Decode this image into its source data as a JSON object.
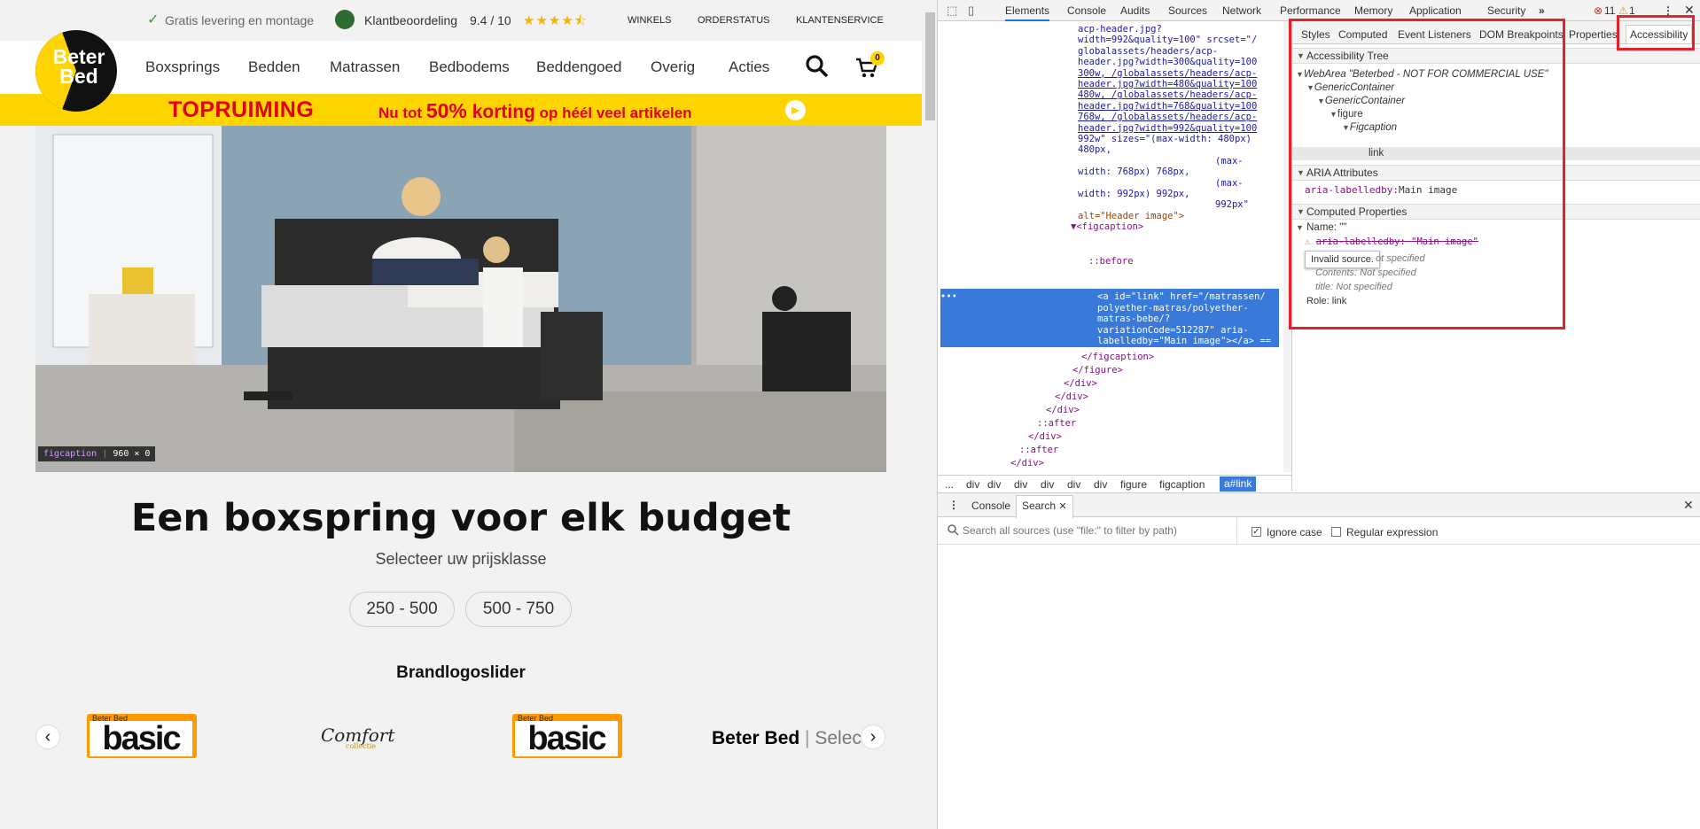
{
  "site": {
    "topbar": {
      "delivery": "Gratis levering en montage",
      "rating_label": "Klantbeoordeling",
      "rating_value": "9.4 / 10",
      "stars": 4.5,
      "links": [
        "WINKELS",
        "ORDERSTATUS",
        "KLANTENSERVICE"
      ]
    },
    "logo": {
      "line1": "Beter",
      "line2": "Bed"
    },
    "nav": [
      "Boxsprings",
      "Bedden",
      "Matrassen",
      "Bedbodems",
      "Beddengoed",
      "Overig",
      "Acties"
    ],
    "cart_count": "0",
    "promo": {
      "title": "TOPRUIMING",
      "pre": "Nu tot ",
      "percent": "50%",
      "korting": " korting",
      "post": " op héél veel artikelen"
    },
    "hero_tooltip": {
      "tag": "figcaption",
      "size": "960 × 0"
    },
    "headline": "Een boxspring voor elk budget",
    "subheading": "Selecteer uw prijsklasse",
    "price_ranges": [
      "250 - 500",
      "500 - 750"
    ],
    "brand_title": "Brandlogoslider",
    "brands": {
      "basic_small": "Beter Bed",
      "basic": "basic",
      "comfort": "Comfort",
      "comfort_sub": "collectie",
      "select_brand": "Beter Bed",
      "select_word": "Select"
    }
  },
  "devtools": {
    "tabs": [
      "Elements",
      "Console",
      "Audits",
      "Sources",
      "Network",
      "Performance",
      "Memory",
      "Application",
      "Security"
    ],
    "active_tab": "Elements",
    "errors": "11",
    "warnings": "1",
    "code_lines": [
      {
        "text": "acp-header.jpg?",
        "cls": "av"
      },
      {
        "text": "width=992&quality=100\" srcset=\"/",
        "cls": "av"
      },
      {
        "text": "globalassets/headers/acp-",
        "cls": "av"
      },
      {
        "text": "header.jpg?width=300&quality=100",
        "cls": "av"
      },
      {
        "text": "300w, /globalassets/headers/acp-",
        "cls": "av"
      },
      {
        "text": "header.jpg?width=480&quality=100",
        "cls": "av"
      },
      {
        "text": "480w, /globalassets/headers/acp-",
        "cls": "av"
      },
      {
        "text": "header.jpg?width=768&quality=100",
        "cls": "av"
      },
      {
        "text": "768w, /globalassets/headers/acp-",
        "cls": "av"
      },
      {
        "text": "header.jpg?width=992&quality=100",
        "cls": "av"
      },
      {
        "text": "992w\" sizes=\"(max-width: 480px)",
        "cls": "av"
      },
      {
        "text": "480px,",
        "cls": "av"
      },
      {
        "text": "(max-",
        "cls": "av"
      },
      {
        "text": "width: 768px) 768px,",
        "cls": "av"
      },
      {
        "text": "(max-",
        "cls": "av"
      },
      {
        "text": "width: 992px) 992px,",
        "cls": "av"
      },
      {
        "text": "992px\"",
        "cls": "av"
      },
      {
        "text": "alt=\"Header image\">",
        "cls": "an"
      },
      {
        "text": "▼<figcaption>",
        "cls": "tag"
      }
    ],
    "before": "::before",
    "selected_lines": [
      "<a id=\"link\" href=\"/matrassen/",
      "polyether-matras/polyether-",
      "matras-bebe/?",
      "variationCode=512287\" aria-",
      "labelledby=\"Main image\"></a> == "
    ],
    "closing_lines": [
      "</figcaption>",
      "</figure>",
      "</div>",
      "</div>",
      "</div>",
      "::after",
      "</div>",
      "::after",
      "</div>",
      "</div>"
    ],
    "breadcrumb": [
      "...",
      "div",
      "div",
      "div",
      "div",
      "div",
      "div",
      "figure",
      "figcaption",
      "a#link"
    ],
    "side_tabs": [
      "Styles",
      "Computed",
      "Event Listeners",
      "DOM Breakpoints",
      "Properties",
      "Accessibility"
    ],
    "accessibility": {
      "tree_title": "Accessibility Tree",
      "tree": [
        "WebArea \"Beterbed - NOT FOR COMMERCIAL USE\"",
        "GenericContainer",
        "GenericContainer",
        "figure",
        "Figcaption",
        "link"
      ],
      "aria_title": "ARIA Attributes",
      "aria_name": "aria-labelledby:",
      "aria_value": "Main image",
      "computed_title": "Computed Properties",
      "name_label": "Name: \"\"",
      "labelledby_struck": "aria-labelledby: \"Main image\"",
      "tooltip": "Invalid source.",
      "not_specified_1": "ot specified",
      "contents": "Contents: Not specified",
      "title": "title: Not specified",
      "role": "Role: link"
    },
    "drawer": {
      "tabs": [
        "Console",
        "Search"
      ],
      "search_placeholder": "Search all sources (use \"file:\" to filter by path)",
      "ignore_case": "Ignore case",
      "regex": "Regular expression"
    }
  },
  "colors": {
    "brand_yellow": "#ffd500",
    "devtools_blue": "#3879d9",
    "highlight_red": "#e8202a"
  }
}
